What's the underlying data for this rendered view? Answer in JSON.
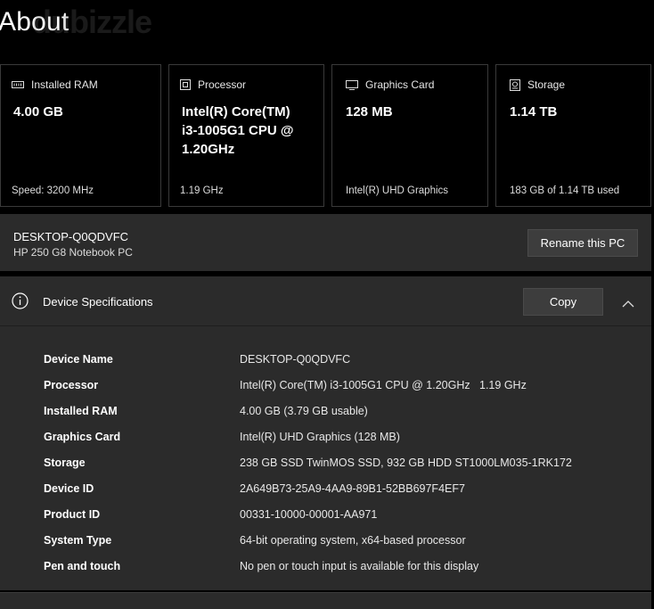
{
  "page": {
    "title": "About",
    "watermark": "dubizzle"
  },
  "cards": [
    {
      "icon": "ram-icon",
      "label": "Installed RAM",
      "value": "4.00 GB",
      "sub": "Speed: 3200 MHz"
    },
    {
      "icon": "processor-icon",
      "label": "Processor",
      "value": "Intel(R) Core(TM) i3-1005G1 CPU @ 1.20GHz",
      "sub": "1.19 GHz"
    },
    {
      "icon": "graphics-card-icon",
      "label": "Graphics Card",
      "value": "128 MB",
      "sub": "Intel(R) UHD Graphics"
    },
    {
      "icon": "storage-icon",
      "label": "Storage",
      "value": "1.14 TB",
      "sub": "183 GB of 1.14 TB used"
    }
  ],
  "pc": {
    "name": "DESKTOP-Q0QDVFC",
    "model": "HP 250 G8 Notebook PC",
    "rename_label": "Rename this PC"
  },
  "specs": {
    "title": "Device Specifications",
    "copy_label": "Copy",
    "rows": [
      {
        "key": "Device Name",
        "value": "DESKTOP-Q0QDVFC"
      },
      {
        "key": "Processor",
        "value": "Intel(R) Core(TM) i3-1005G1 CPU @ 1.20GHz   1.19 GHz"
      },
      {
        "key": "Installed RAM",
        "value": "4.00 GB (3.79 GB usable)"
      },
      {
        "key": "Graphics Card",
        "value": "Intel(R) UHD Graphics (128 MB)"
      },
      {
        "key": "Storage",
        "value": "238 GB SSD TwinMOS SSD, 932 GB HDD ST1000LM035-1RK172"
      },
      {
        "key": "Device ID",
        "value": "2A649B73-25A9-4AA9-89B1-52BB697F4EF7"
      },
      {
        "key": "Product ID",
        "value": "00331-10000-00001-AA971"
      },
      {
        "key": "System Type",
        "value": "64-bit operating system, x64-based processor"
      },
      {
        "key": "Pen and touch",
        "value": "No pen or touch input is available for this display"
      }
    ]
  }
}
